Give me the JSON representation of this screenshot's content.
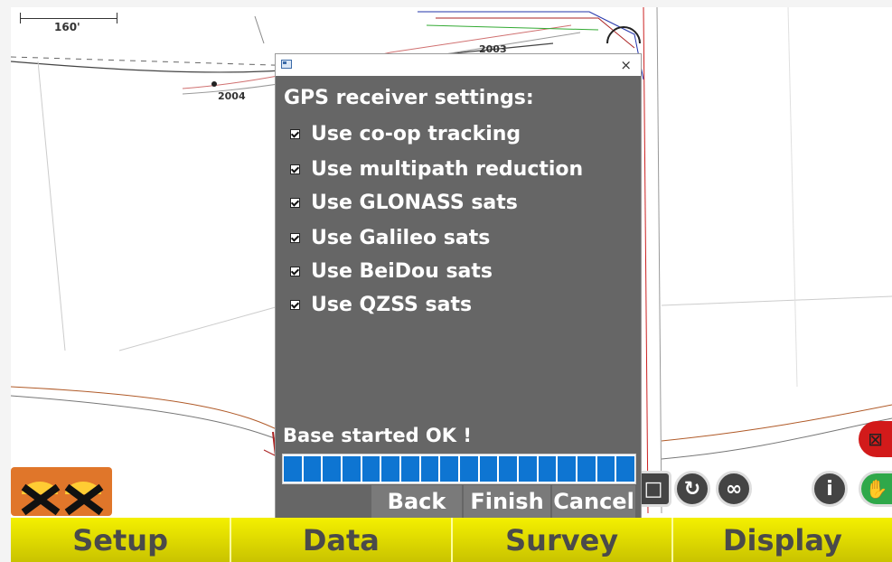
{
  "map": {
    "scale_label": "160'",
    "labels": [
      "2004",
      "2003"
    ]
  },
  "dialog": {
    "heading": "GPS receiver settings:",
    "options": [
      {
        "label": "Use co-op tracking",
        "checked": true
      },
      {
        "label": "Use multipath reduction",
        "checked": true
      },
      {
        "label": "Use GLONASS sats",
        "checked": true
      },
      {
        "label": "Use Galileo sats",
        "checked": true
      },
      {
        "label": "Use BeiDou sats",
        "checked": true
      },
      {
        "label": "Use QZSS sats",
        "checked": true
      }
    ],
    "status": "Base started OK !",
    "progress_fraction": 1.0,
    "buttons": {
      "back": "Back",
      "finish": "Finish",
      "cancel": "Cancel"
    },
    "close_glyph": "×"
  },
  "toolbar": {
    "icons": [
      "stop-icon",
      "rotate-icon",
      "infinity-icon",
      "info-icon",
      "hand-icon"
    ]
  },
  "bottom_tabs": [
    "Setup",
    "Data",
    "Survey",
    "Display"
  ],
  "colors": {
    "dialog_bg": "#666666",
    "progress": "#0e75d2",
    "tab_bar": "#f4f000",
    "tab_text": "#4a4a4a",
    "badge": "#e0762a",
    "red_icon": "#d21a1a",
    "hand_icon": "#2fa84a"
  }
}
